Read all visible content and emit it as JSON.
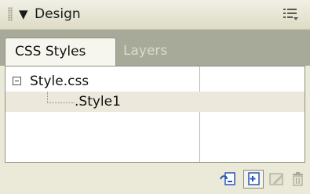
{
  "panel": {
    "title": "Design",
    "collapse_glyph": "▼",
    "options_icon": "options-menu-icon"
  },
  "tabs": [
    {
      "label": "CSS Styles",
      "active": true
    },
    {
      "label": "Layers",
      "active": false
    }
  ],
  "tree": {
    "items": [
      {
        "label": "Style.css",
        "expanded": true,
        "level": 0
      },
      {
        "label": ".Style1",
        "selected": true,
        "level": 1
      }
    ]
  },
  "toolbar": {
    "buttons": [
      {
        "icon": "attach-stylesheet-icon"
      },
      {
        "icon": "new-style-icon"
      },
      {
        "icon": "edit-style-icon",
        "enabled": false
      },
      {
        "icon": "delete-icon",
        "enabled": false
      }
    ]
  },
  "colors": {
    "panel_bg": "#ebe9d8",
    "tab_strip": "#a7aa99",
    "selected_row": "#ece9dc",
    "icon_accent": "#2a55b8"
  }
}
